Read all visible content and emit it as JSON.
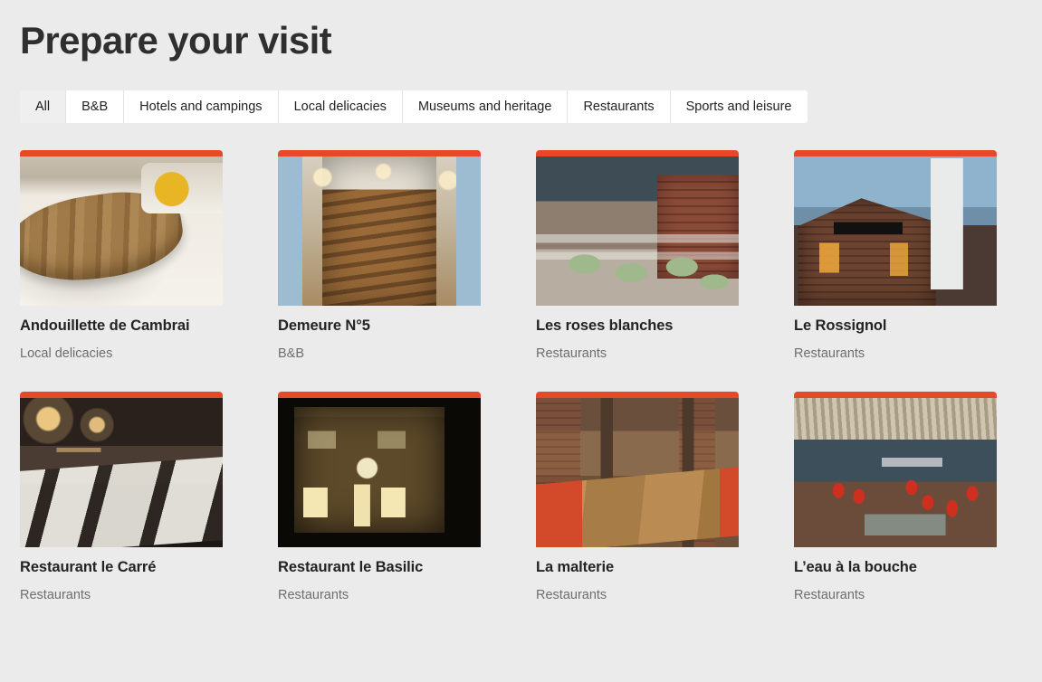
{
  "header": {
    "title": "Prepare your visit"
  },
  "accent_color": "#e8482a",
  "background_color": "#ebebeb",
  "tabs": [
    {
      "label": "All",
      "active": true
    },
    {
      "label": "B&B",
      "active": false
    },
    {
      "label": "Hotels and campings",
      "active": false
    },
    {
      "label": "Local delicacies",
      "active": false
    },
    {
      "label": "Museums and heritage",
      "active": false
    },
    {
      "label": "Restaurants",
      "active": false
    },
    {
      "label": "Sports and leisure",
      "active": false
    }
  ],
  "cards": [
    {
      "title": "Andouillette de Cambrai",
      "category": "Local delicacies",
      "image_name": "plate-of-andouillette-sausages-photo",
      "image_style": "ph-sausages"
    },
    {
      "title": "Demeure N°5",
      "category": "B&B",
      "image_name": "guesthouse-hallway-staircase-photo",
      "image_style": "ph-hallway"
    },
    {
      "title": "Les roses blanches",
      "category": "Restaurants",
      "image_name": "bistro-interior-green-chairs-photo",
      "image_style": "ph-bistro"
    },
    {
      "title": "Le Rossignol",
      "category": "Restaurants",
      "image_name": "brick-restaurant-facade-dusk-photo",
      "image_style": "ph-facade"
    },
    {
      "title": "Restaurant le Carré",
      "category": "Restaurants",
      "image_name": "elegant-dining-room-chandeliers-photo",
      "image_style": "ph-elegant"
    },
    {
      "title": "Restaurant le Basilic",
      "category": "Restaurants",
      "image_name": "lit-restaurant-facade-night-photo",
      "image_style": "ph-night"
    },
    {
      "title": "La malterie",
      "category": "Restaurants",
      "image_name": "rustic-brick-dining-hall-photo",
      "image_style": "ph-rustic"
    },
    {
      "title": "L’eau à la bouche",
      "category": "Restaurants",
      "image_name": "beamed-dining-hall-red-napkins-photo",
      "image_style": "ph-hall"
    }
  ]
}
